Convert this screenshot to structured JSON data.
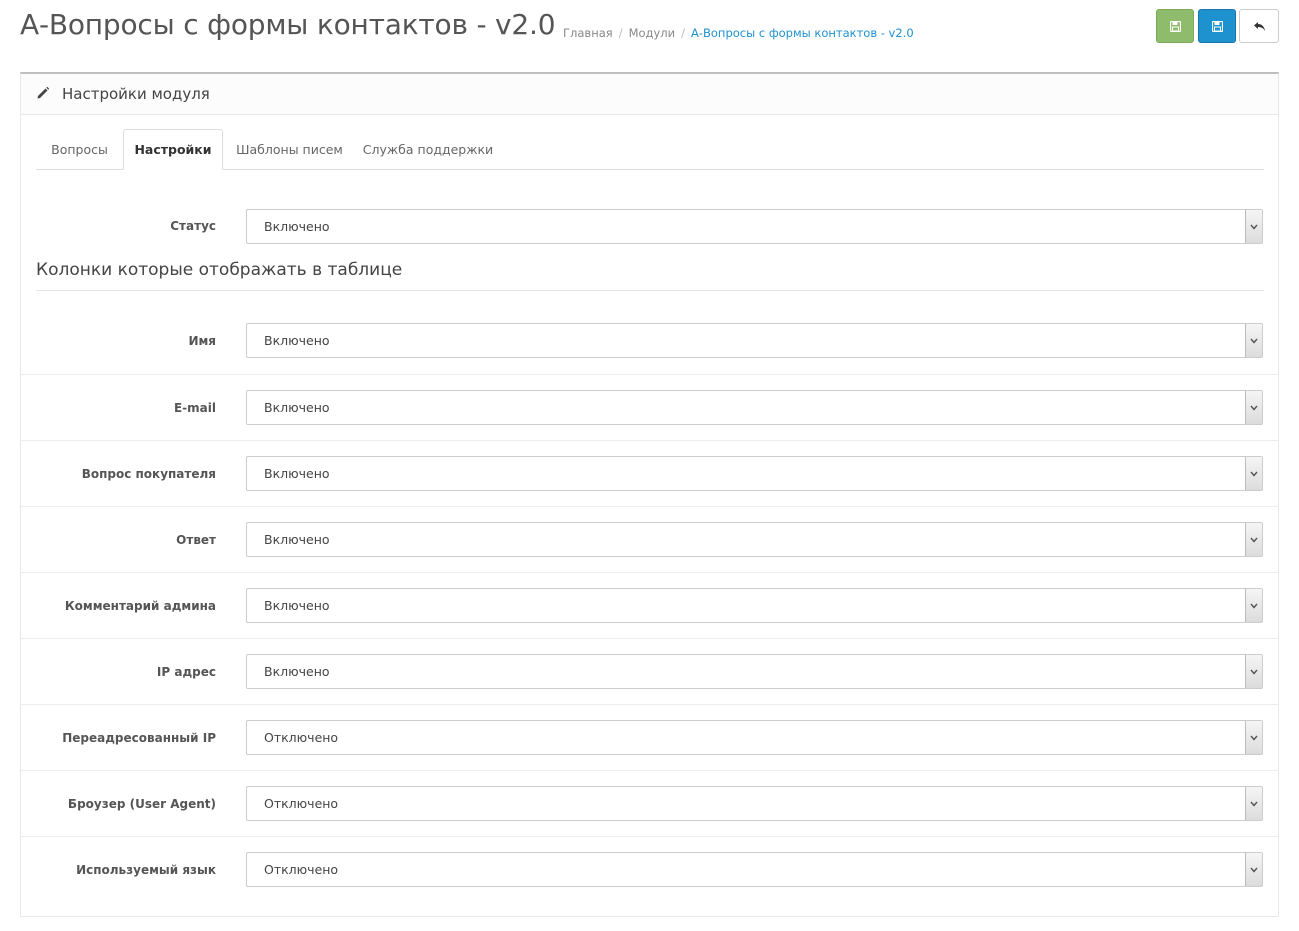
{
  "header": {
    "title": "А-Вопросы с формы контактов - v2.0",
    "breadcrumbs": [
      "Главная",
      "Модули",
      "А-Вопросы с формы контактов - v2.0"
    ]
  },
  "toolbar": {
    "save_stay_icon": "save-icon",
    "save_icon": "save-icon",
    "back_icon": "reply-icon"
  },
  "panel": {
    "title": "Настройки модуля",
    "icon": "pencil-icon"
  },
  "tabs": [
    {
      "label": "Вопросы"
    },
    {
      "label": "Настройки",
      "active": true
    },
    {
      "label": "Шаблоны писем"
    },
    {
      "label": "Служба поддержки"
    }
  ],
  "status": {
    "label": "Статус",
    "value": "Включено"
  },
  "columns_heading": "Колонки которые отображать в таблице",
  "columns": [
    {
      "label": "Имя",
      "value": "Включено"
    },
    {
      "label": "E-mail",
      "value": "Включено"
    },
    {
      "label": "Вопрос покупателя",
      "value": "Включено"
    },
    {
      "label": "Ответ",
      "value": "Включено"
    },
    {
      "label": "Комментарий админа",
      "value": "Включено"
    },
    {
      "label": "IP адрес",
      "value": "Включено"
    },
    {
      "label": "Переадресованный IP",
      "value": "Отключено"
    },
    {
      "label": "Броузер (User Agent)",
      "value": "Отключено"
    },
    {
      "label": "Используемый язык",
      "value": "Отключено"
    }
  ],
  "colors": {
    "primary": "#1e91cf",
    "success": "#8fbb6c"
  }
}
